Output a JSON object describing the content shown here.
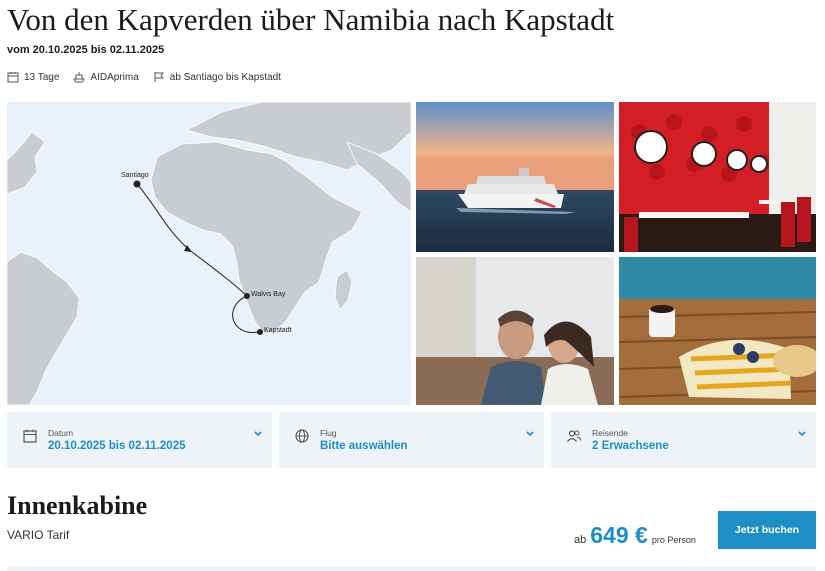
{
  "header": {
    "title": "Von den Kapverden über Namibia nach Kapstadt",
    "subtitle": "vom 20.10.2025 bis 02.11.2025"
  },
  "meta": {
    "duration": "13 Tage",
    "ship": "AIDAprima",
    "route": "ab Santiago bis Kapstadt",
    "icons": [
      "calendar-icon",
      "ship-icon",
      "flag-icon"
    ]
  },
  "map": {
    "ports": [
      "Santiago",
      "Walvis Bay",
      "Kapstadt"
    ]
  },
  "selectors": [
    {
      "label": "Datum",
      "value": "20.10.2025 bis 02.11.2025",
      "icon": "calendar-icon"
    },
    {
      "label": "Flug",
      "value": "Bitte auswählen",
      "icon": "globe-icon"
    },
    {
      "label": "Reisende",
      "value": "2 Erwachsene",
      "icon": "people-icon"
    }
  ],
  "offer": {
    "cabin": "Innenkabine",
    "tarif": "VARIO Tarif",
    "price_prefix": "ab",
    "price": "649 €",
    "price_suffix": "pro Person",
    "cta": "Jetzt buchen"
  },
  "colors": {
    "accent": "#1e8fc6",
    "panel": "#eef3f8",
    "map_water": "#e9f1fa",
    "map_land": "#c9ccd1"
  }
}
